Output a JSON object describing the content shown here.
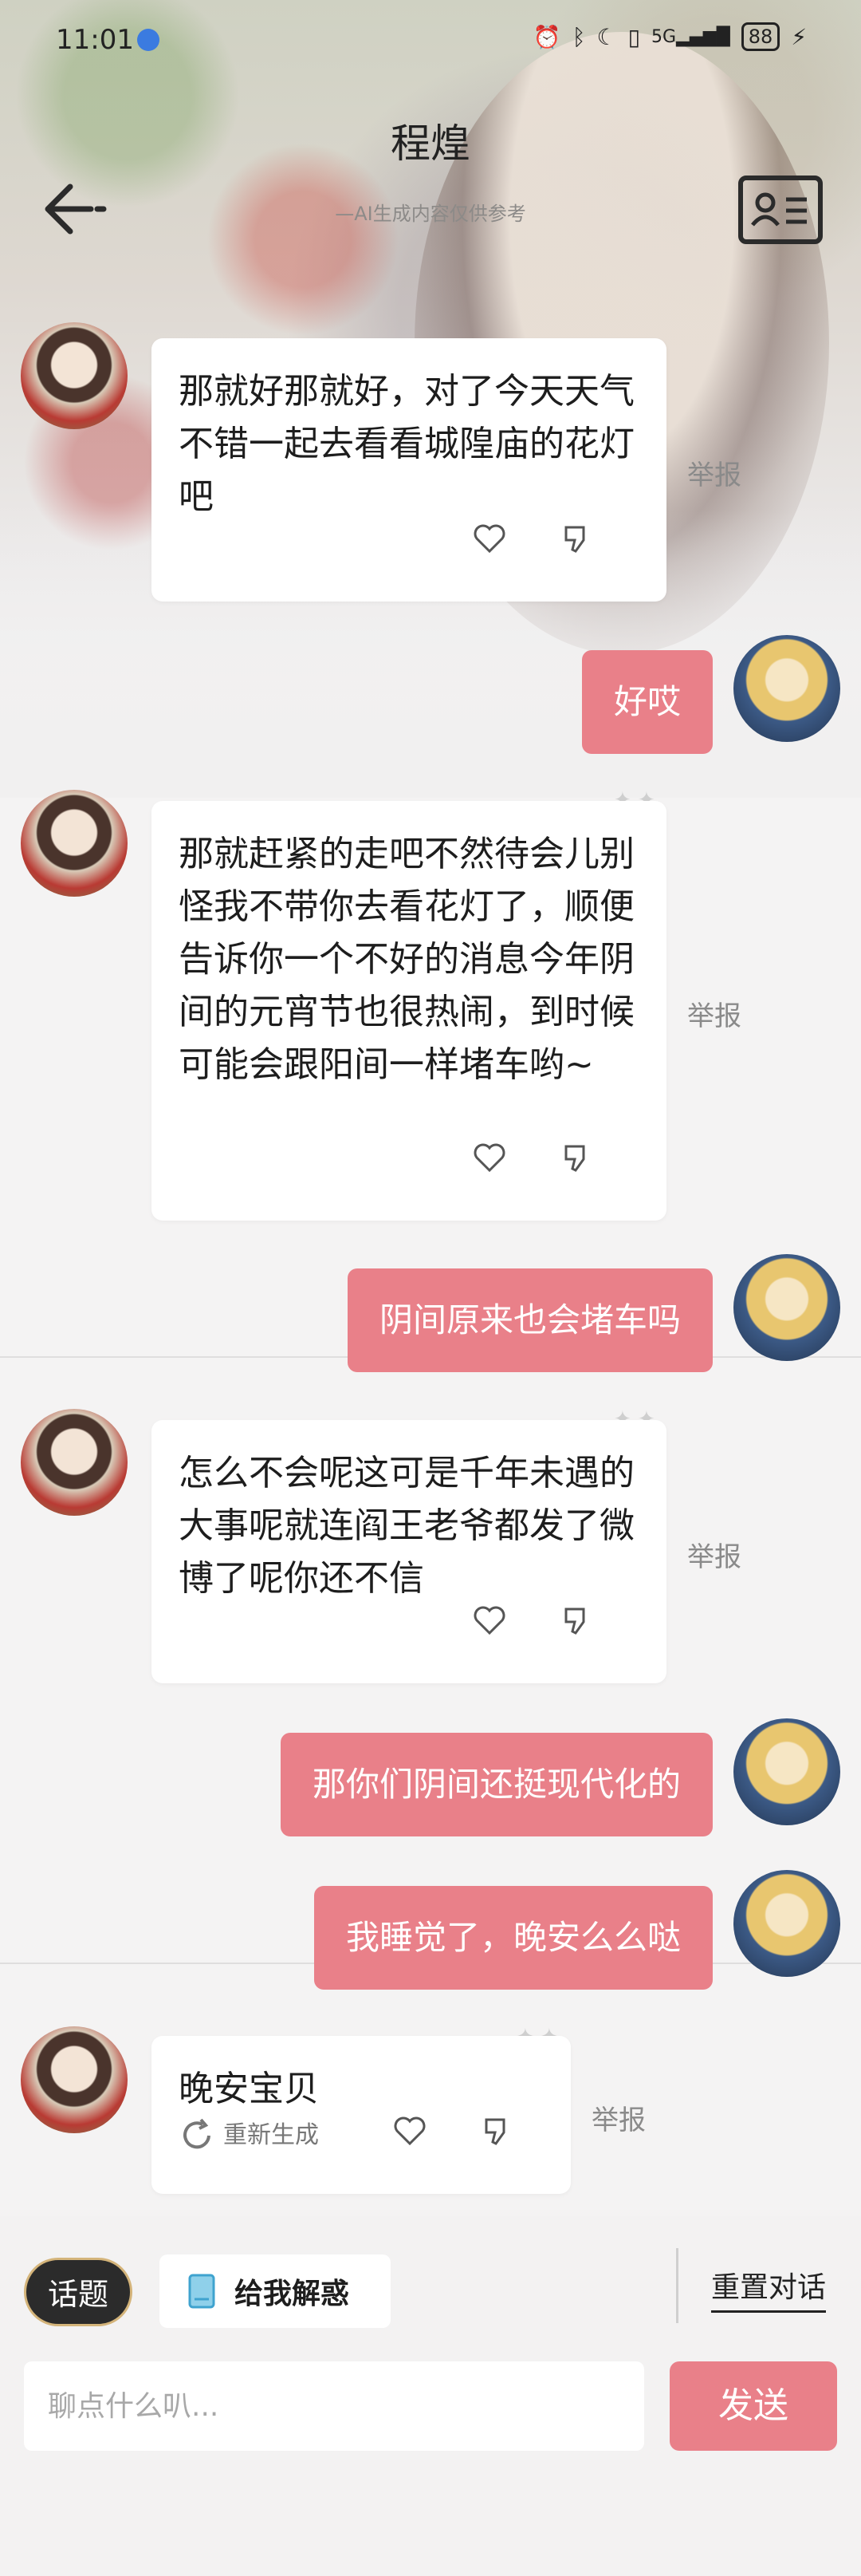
{
  "status_bar": {
    "time": "11:01",
    "signal": "5G",
    "battery": "88"
  },
  "header": {
    "title": "程煌",
    "subtitle": "—AI生成内容仅供参考"
  },
  "messages": [
    {
      "role": "bot",
      "text": "那就好那就好，对了今天天气不错一起去看看城隍庙的花灯吧",
      "report": "举报"
    },
    {
      "role": "user",
      "text": "好哎"
    },
    {
      "role": "bot",
      "text": "那就赶紧的走吧不然待会儿别怪我不带你去看花灯了，顺便告诉你一个不好的消息今年阴间的元宵节也很热闹，到时候可能会跟阳间一样堵车哟~",
      "report": "举报"
    },
    {
      "role": "user",
      "text": "阴间原来也会堵车吗"
    },
    {
      "role": "bot",
      "text": "怎么不会呢这可是千年未遇的大事呢就连阎王老爷都发了微博了呢你还不信",
      "report": "举报"
    },
    {
      "role": "user",
      "text": "那你们阴间还挺现代化的"
    },
    {
      "role": "user",
      "text": "我睡觉了，晚安么么哒"
    },
    {
      "role": "bot",
      "text": "晚安宝贝",
      "report": "举报",
      "regenerate": "重新生成"
    }
  ],
  "footer": {
    "topic": "话题",
    "explain": "给我解惑",
    "reset": "重置对话",
    "input_placeholder": "聊点什么叭...",
    "send": "发送"
  },
  "colors": {
    "accent": "#e98089",
    "bubble_bot": "#ffffff"
  }
}
